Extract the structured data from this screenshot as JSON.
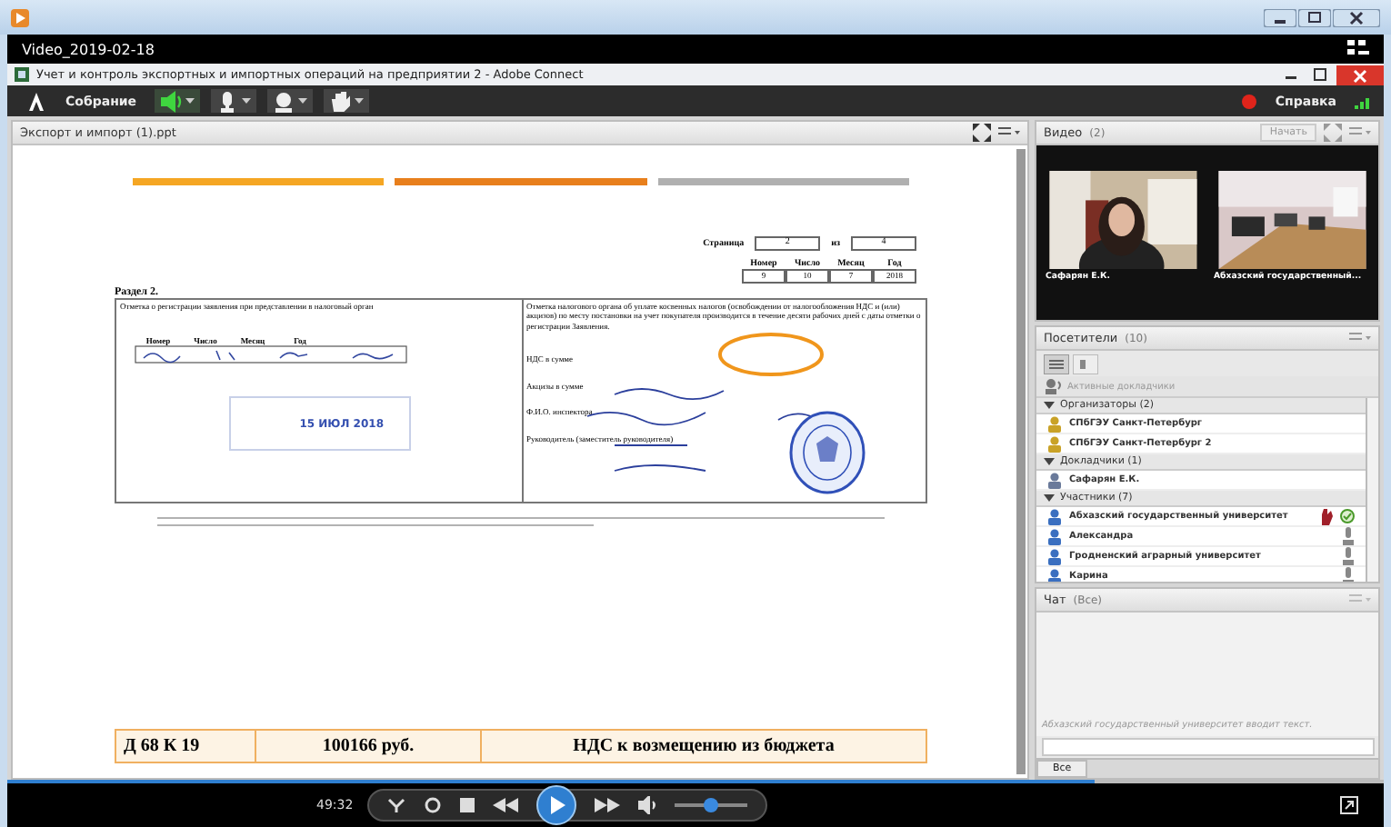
{
  "player": {
    "title": "Video_2019-02-18",
    "time": "49:32",
    "seek": {
      "level": 0.79
    },
    "volume": {
      "level": 0.5
    }
  },
  "app": {
    "title": "Учет и контроль экспортных и импортных операций на предприятии 2 - Adobe Connect"
  },
  "menubar": {
    "meeting": "Собрание",
    "tools": [
      {
        "kind": "speaker",
        "on": true
      },
      {
        "kind": "mic",
        "on": false
      },
      {
        "kind": "camera",
        "on": false
      },
      {
        "kind": "hand",
        "on": false
      }
    ],
    "help": "Справка"
  },
  "share_pod": {
    "title": "Экспорт и импорт (1).ppt",
    "slide": {
      "page_label": "Страница",
      "page": "2",
      "of": "из",
      "pages": "4",
      "date_fields": [
        {
          "label": "Номер",
          "value": "9"
        },
        {
          "label": "Число",
          "value": "10"
        },
        {
          "label": "Месяц",
          "value": "7"
        },
        {
          "label": "Год",
          "value": "2018"
        }
      ],
      "section": "Раздел 2.",
      "left_heading": "Отметка о регистрации заявления при представлении в налоговый орган",
      "left_fields": [
        "Номер",
        "Число",
        "Месяц",
        "Год"
      ],
      "stamp_date": "15 ИЮЛ 2018",
      "right_heading": "Отметка налогового органа об уплате косвенных налогов (освобождении от налогообложения НДС и (или) акцизов) по месту постановки на учет покупателя производится в течение десяти рабочих дней с даты отметки о регистрации Заявления.",
      "right_fields": [
        "НДС в сумме",
        "Акцизы в сумме",
        "Ф.И.О. инспектора",
        "Руководитель (заместитель руководителя)"
      ],
      "summary": [
        "Д 68 К 19",
        "100166 руб.",
        "НДС к возмещению из бюджета"
      ]
    }
  },
  "video_pod": {
    "title": "Видео",
    "count": "(2)",
    "start": "Начать",
    "feeds": [
      {
        "name": "Сафарян Е.К.",
        "kind": "person"
      },
      {
        "name": "Абхазский государственный...",
        "kind": "room"
      }
    ]
  },
  "attendees_pod": {
    "title": "Посетители",
    "count": "(10)",
    "active_speakers": "Активные докладчики",
    "groups": [
      {
        "label": "Организаторы (2)",
        "expanded": true,
        "children": [
          {
            "name": "СПбГЭУ Санкт-Петербург",
            "kind": "host",
            "hand_raised": false
          },
          {
            "name": "СПбГЭУ Санкт-Петербург 2",
            "kind": "host",
            "hand_raised": false
          }
        ]
      },
      {
        "label": "Докладчики (1)",
        "expanded": true,
        "children": [
          {
            "name": "Сафарян Е.К.",
            "kind": "presenter",
            "hand_raised": false
          }
        ]
      },
      {
        "label": "Участники (7)",
        "expanded": true,
        "children": [
          {
            "name": "Абхазский государственный университет",
            "kind": "participant",
            "hand_raised": true
          },
          {
            "name": "Александра",
            "kind": "participant",
            "hand_raised": false
          },
          {
            "name": "Гродненский аграрный университет",
            "kind": "participant",
            "hand_raised": false
          },
          {
            "name": "Карина",
            "kind": "participant",
            "hand_raised": false
          }
        ]
      }
    ]
  },
  "chat_pod": {
    "title": "Чат",
    "scope": "(Все)",
    "typing": "Абхазский государственный университет вводит текст.",
    "tab": "Все"
  }
}
